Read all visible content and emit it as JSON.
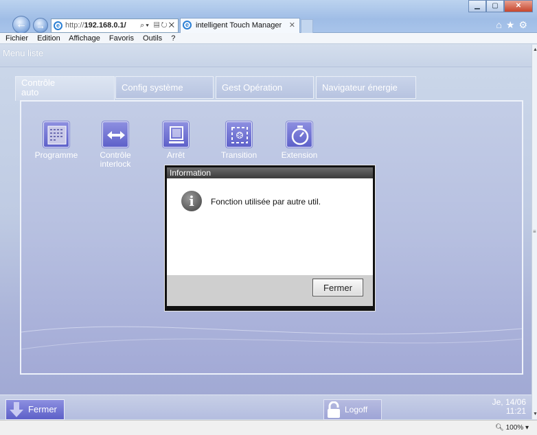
{
  "browser": {
    "address": "http://192.168.0.1/",
    "address_prefix": "http://",
    "address_host": "192.168.0.1/",
    "tab_title": "intelligent Touch Manager",
    "menu": [
      "Fichier",
      "Edition",
      "Affichage",
      "Favoris",
      "Outils",
      "?"
    ],
    "zoom": "100%"
  },
  "app": {
    "menu_liste": "Menu liste",
    "tabs": [
      {
        "label_line1": "Contrôle",
        "label_line2": "auto",
        "active": true
      },
      {
        "label": "Config système"
      },
      {
        "label": "Gest Opération"
      },
      {
        "label": "Navigateur énergie"
      }
    ],
    "functions": [
      {
        "label1": "Programme",
        "label2": "",
        "icon": "calendar-icon"
      },
      {
        "label1": "Contrôle",
        "label2": "interlock",
        "icon": "interlock-arrows-icon"
      },
      {
        "label1": "Arrêt",
        "label2": "",
        "icon": "stop-icon"
      },
      {
        "label1": "Transition",
        "label2": "",
        "icon": "transition-icon"
      },
      {
        "label1": "Extension",
        "label2": "",
        "icon": "timer-icon"
      }
    ],
    "dialog": {
      "title": "Information",
      "message": "Fonction utilisée par autre util.",
      "button": "Fermer"
    },
    "bottom": {
      "fermer": "Fermer",
      "logoff": "Logoff",
      "date": "Je, 14/06",
      "time": "11:21"
    }
  }
}
